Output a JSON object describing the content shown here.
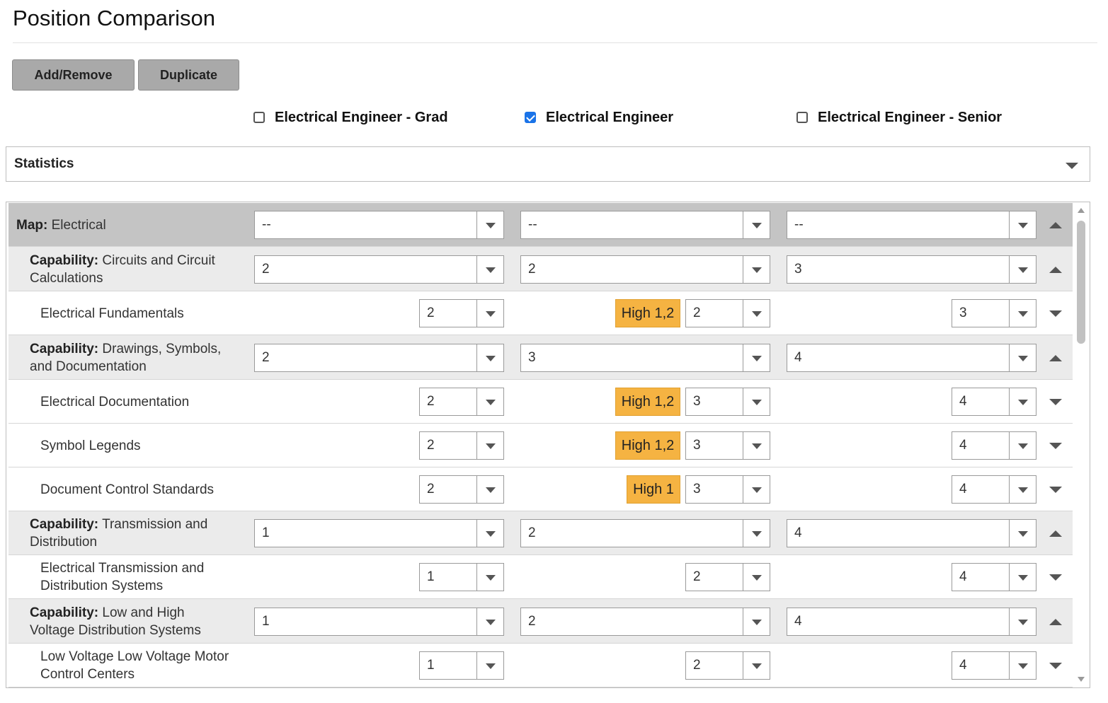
{
  "page": {
    "title": "Position Comparison"
  },
  "toolbar": {
    "add_remove_label": "Add/Remove",
    "duplicate_label": "Duplicate"
  },
  "positions": [
    {
      "name": "Electrical Engineer - Grad",
      "checked": false
    },
    {
      "name": "Electrical Engineer",
      "checked": true
    },
    {
      "name": "Electrical Engineer - Senior",
      "checked": false
    }
  ],
  "statistics": {
    "label": "Statistics",
    "expanded": false
  },
  "grid": {
    "rows": [
      {
        "type": "map",
        "prefix": "Map:",
        "name": "Electrical",
        "values": [
          "--",
          "--",
          "--"
        ],
        "toggle": "collapse"
      },
      {
        "type": "capability",
        "prefix": "Capability:",
        "name": "Circuits and Circuit Calculations",
        "values": [
          "2",
          "2",
          "3"
        ],
        "toggle": "collapse"
      },
      {
        "type": "competency",
        "name": "Electrical Fundamentals",
        "values": [
          "2",
          "2",
          "3"
        ],
        "badge": "High 1,2",
        "toggle": "expand"
      },
      {
        "type": "capability",
        "prefix": "Capability:",
        "name": "Drawings, Symbols, and Documentation",
        "values": [
          "2",
          "3",
          "4"
        ],
        "toggle": "collapse"
      },
      {
        "type": "competency",
        "name": "Electrical Documentation",
        "values": [
          "2",
          "3",
          "4"
        ],
        "badge": "High 1,2",
        "toggle": "expand"
      },
      {
        "type": "competency",
        "name": "Symbol Legends",
        "values": [
          "2",
          "3",
          "4"
        ],
        "badge": "High 1,2",
        "toggle": "expand"
      },
      {
        "type": "competency",
        "name": "Document Control Standards",
        "values": [
          "2",
          "3",
          "4"
        ],
        "badge": "High 1",
        "toggle": "expand"
      },
      {
        "type": "capability",
        "prefix": "Capability:",
        "name": "Transmission and Distribution",
        "values": [
          "1",
          "2",
          "4"
        ],
        "toggle": "collapse"
      },
      {
        "type": "competency",
        "name": "Electrical Transmission and Distribution Systems",
        "values": [
          "1",
          "2",
          "4"
        ],
        "badge": "",
        "toggle": "expand"
      },
      {
        "type": "capability",
        "prefix": "Capability:",
        "name": "Low and High Voltage Distribution Systems",
        "values": [
          "1",
          "2",
          "4"
        ],
        "toggle": "collapse"
      },
      {
        "type": "competency",
        "name": "Low Voltage Low Voltage Motor Control Centers",
        "values": [
          "1",
          "2",
          "4"
        ],
        "badge": "",
        "toggle": "expand"
      }
    ]
  },
  "colors": {
    "badge": "#f5b342",
    "map_row": "#c4c4c4",
    "capability_row": "#ebebeb",
    "checkbox_checked": "#1a73e8"
  }
}
